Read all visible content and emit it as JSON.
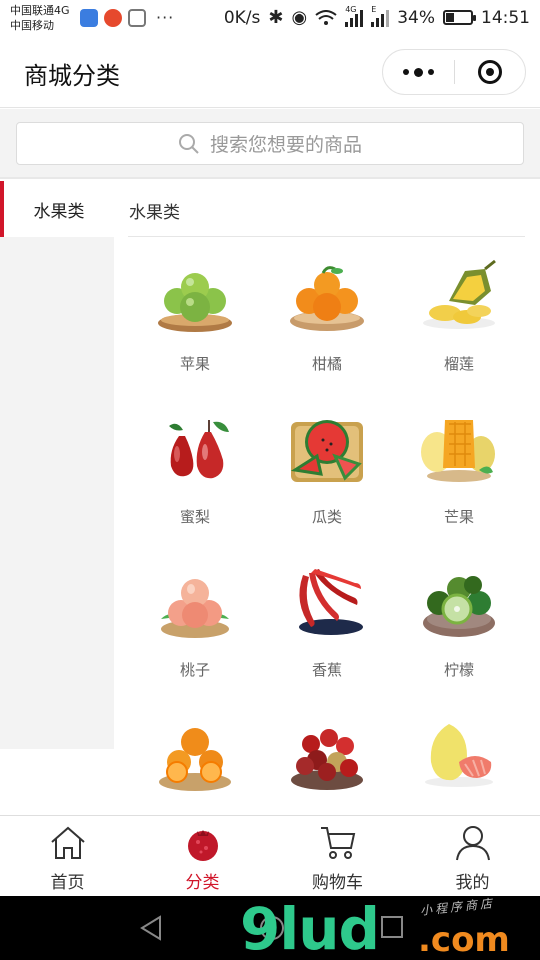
{
  "status_bar": {
    "carrier1": "中国联通4G",
    "carrier2": "中国移动",
    "dots": "···",
    "speed": "0K/s",
    "net1": "4G",
    "net2": "E",
    "battery": "34%",
    "battery_level": 0.34,
    "time": "14:51"
  },
  "header": {
    "title": "商城分类",
    "menu_icon": "more-dots-icon",
    "close_icon": "target-close-icon"
  },
  "search": {
    "placeholder": "搜索您想要的商品",
    "icon": "search-icon"
  },
  "sidebar": {
    "items": [
      {
        "label": "水果类",
        "active": true
      }
    ]
  },
  "content": {
    "category_title": "水果类",
    "items": [
      {
        "name": "苹果",
        "icon": "apple-image"
      },
      {
        "name": "柑橘",
        "icon": "orange-image"
      },
      {
        "name": "榴莲",
        "icon": "durian-image"
      },
      {
        "name": "蜜梨",
        "icon": "pear-image"
      },
      {
        "name": "瓜类",
        "icon": "watermelon-image"
      },
      {
        "name": "芒果",
        "icon": "mango-image"
      },
      {
        "name": "桃子",
        "icon": "peach-image"
      },
      {
        "name": "香蕉",
        "icon": "banana-image"
      },
      {
        "name": "柠檬",
        "icon": "lime-image"
      },
      {
        "name": "",
        "icon": "orange-halves-image"
      },
      {
        "name": "",
        "icon": "jujube-image"
      },
      {
        "name": "",
        "icon": "pomelo-image"
      }
    ]
  },
  "tabbar": {
    "tabs": [
      {
        "label": "首页",
        "icon": "home-icon",
        "active": false
      },
      {
        "label": "分类",
        "icon": "pomegranate-icon",
        "active": true
      },
      {
        "label": "购物车",
        "icon": "cart-icon",
        "active": false
      },
      {
        "label": "我的",
        "icon": "user-icon",
        "active": false
      }
    ],
    "active_color": "#d1162a"
  },
  "watermark": {
    "main": "9lud",
    "suffix": ".com",
    "tagline": "小程序商店"
  }
}
